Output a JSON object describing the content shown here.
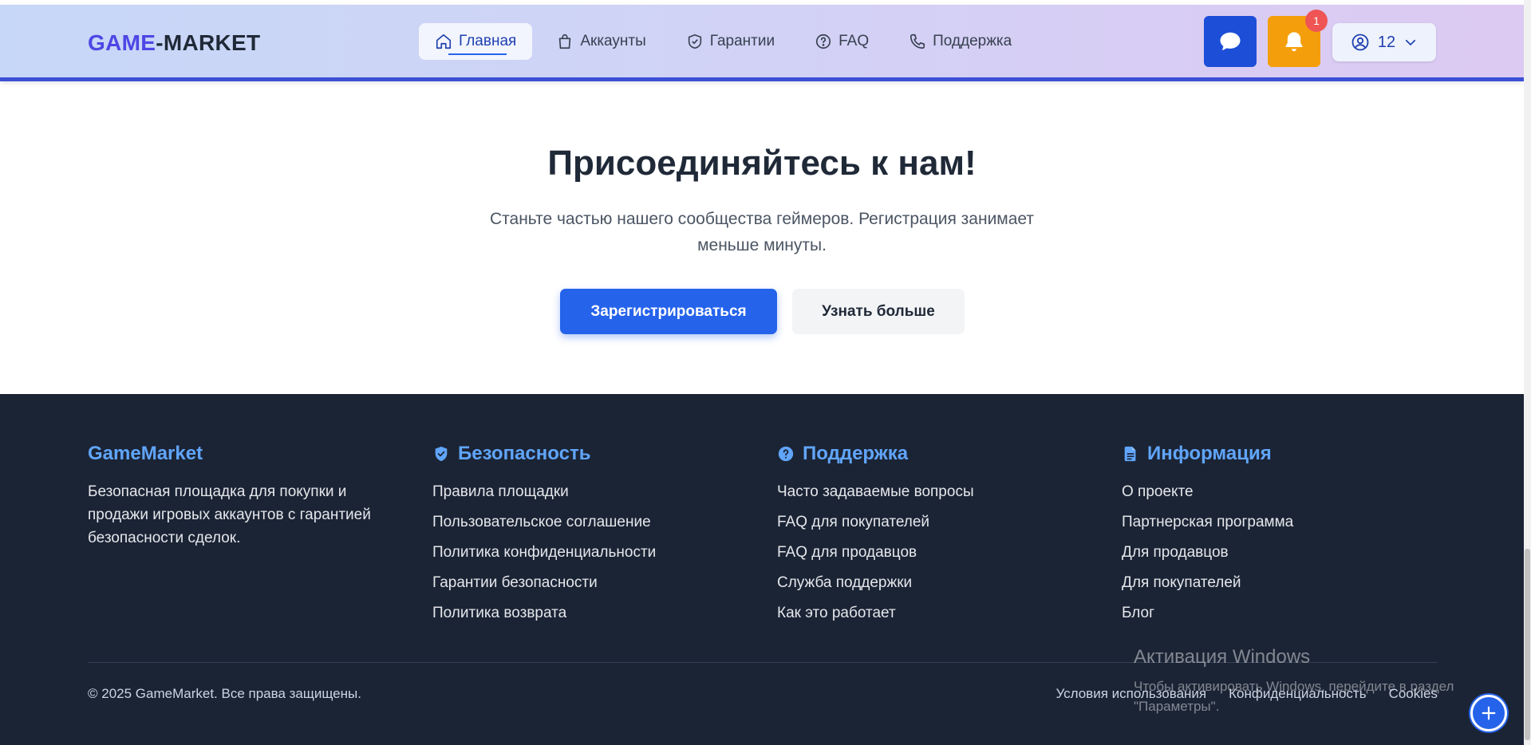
{
  "header": {
    "logo_part1": "GAME",
    "logo_part2": "-MARKET",
    "nav": [
      {
        "label": "Главная",
        "icon": "home-icon"
      },
      {
        "label": "Аккаунты",
        "icon": "bag-icon"
      },
      {
        "label": "Гарантии",
        "icon": "shield-check-icon"
      },
      {
        "label": "FAQ",
        "icon": "question-circle-icon"
      },
      {
        "label": "Поддержка",
        "icon": "phone-icon"
      }
    ],
    "notifications_count": "1",
    "user_label": "12",
    "colors": {
      "accent": "#2563eb",
      "chat_button": "#1d4ed8",
      "bell_button": "#f59e0b",
      "badge": "#ef5555"
    }
  },
  "cta": {
    "title": "Присоединяйтесь к нам!",
    "text": "Станьте частью нашего сообщества геймеров. Регистрация занимает меньше минуты.",
    "primary_label": "Зарегистрироваться",
    "secondary_label": "Узнать больше"
  },
  "footer": {
    "brand": {
      "title": "GameMarket",
      "description": "Безопасная площадка для покупки и продажи игровых аккаунтов с гарантией безопасности сделок."
    },
    "columns": [
      {
        "title": "Безопасность",
        "icon": "shield-icon",
        "links": [
          "Правила площадки",
          "Пользовательское соглашение",
          "Политика конфиденциальности",
          "Гарантии безопасности",
          "Политика возврата"
        ]
      },
      {
        "title": "Поддержка",
        "icon": "question-circle-icon",
        "links": [
          "Часто задаваемые вопросы",
          "FAQ для покупателей",
          "FAQ для продавцов",
          "Служба поддержки",
          "Как это работает"
        ]
      },
      {
        "title": "Информация",
        "icon": "document-icon",
        "links": [
          "О проекте",
          "Партнерская программа",
          "Для продавцов",
          "Для покупателей",
          "Блог"
        ]
      }
    ],
    "copyright": "© 2025 GameMarket. Все права защищены.",
    "bottom_links": [
      "Условия использования",
      "Конфиденциальность",
      "Cookies"
    ]
  },
  "watermark": {
    "title": "Активация Windows",
    "text": "Чтобы активировать Windows, перейдите в раздел \"Параметры\"."
  }
}
